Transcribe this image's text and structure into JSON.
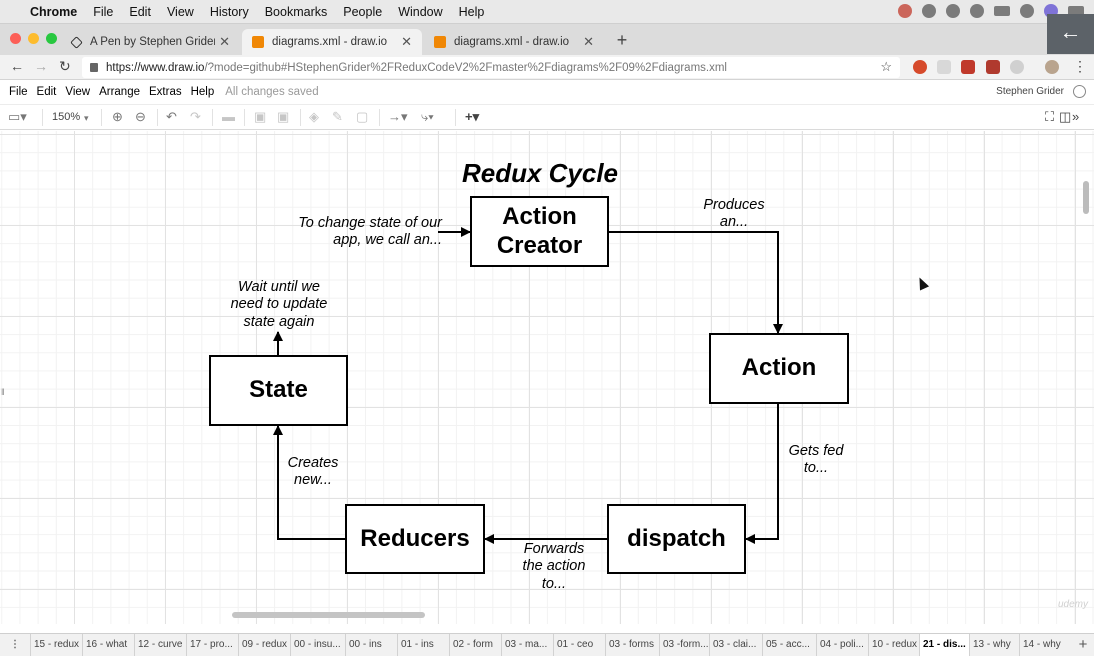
{
  "mac_menubar": {
    "app": "Chrome",
    "items": [
      "File",
      "Edit",
      "View",
      "History",
      "Bookmarks",
      "People",
      "Window",
      "Help"
    ]
  },
  "tabs": [
    {
      "title": "A Pen by Stephen Grider",
      "icon": "codepen-icon",
      "active": false
    },
    {
      "title": "diagrams.xml - draw.io",
      "icon": "drawio-icon",
      "active": true
    },
    {
      "title": "diagrams.xml - draw.io",
      "icon": "drawio-icon",
      "active": false
    }
  ],
  "address": {
    "host": "https://www.draw.io",
    "path": "/?mode=github#HStephenGrider%2FReduxCodeV2%2Fmaster%2Fdiagrams%2F09%2Fdiagrams.xml"
  },
  "app_menu": {
    "items": [
      "File",
      "Edit",
      "View",
      "Arrange",
      "Extras",
      "Help"
    ],
    "status": "All changes saved",
    "user": "Stephen Grider"
  },
  "toolbar": {
    "zoom": "150%"
  },
  "diagram": {
    "title": "Redux Cycle",
    "nodes": {
      "action_creator": "Action Creator",
      "action": "Action",
      "dispatch": "dispatch",
      "reducers": "Reducers",
      "state": "State"
    },
    "notes": {
      "to_change_state": "To change state of our app, we call an...",
      "produces": "Produces an...",
      "gets_fed": "Gets fed to...",
      "forwards": "Forwards the action to...",
      "creates": "Creates new...",
      "wait": "Wait until we need to update state again"
    }
  },
  "page_tabs": [
    "15 - redux",
    "16 - what",
    "12 - curve",
    "17 - pro...",
    "09 - redux",
    "00 - insu...",
    "00 - ins",
    "01 - ins",
    "02 - form",
    "03 - ma...",
    "01 - ceo",
    "03 - forms",
    "03 -form...",
    "03 - clai...",
    "05 - acc...",
    "04 - poli...",
    "10 - redux",
    "21 - dis...",
    "13 - why",
    "14 - why"
  ],
  "active_page_tab": "21 - dis..."
}
